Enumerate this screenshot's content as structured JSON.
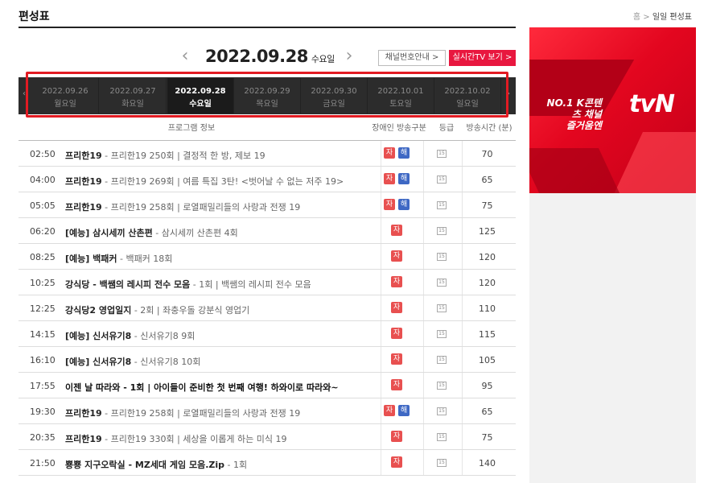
{
  "header": {
    "title": "편성표",
    "breadcrumb_home": "홈",
    "breadcrumb_sep": ">",
    "breadcrumb_current": "일일 편성표"
  },
  "datebar": {
    "prev_symbol": "‹",
    "next_symbol": "›",
    "current_date": "2022.09.28",
    "current_dow": "수요일",
    "guide_label": "채널번호안내 >",
    "live_label": "실시간TV 보기 >"
  },
  "days": [
    {
      "date": "2022.09.26",
      "dow": "월요일",
      "active": false
    },
    {
      "date": "2022.09.27",
      "dow": "화요일",
      "active": false
    },
    {
      "date": "2022.09.28",
      "dow": "수요일",
      "active": true
    },
    {
      "date": "2022.09.29",
      "dow": "목요일",
      "active": false
    },
    {
      "date": "2022.09.30",
      "dow": "금요일",
      "active": false
    },
    {
      "date": "2022.10.01",
      "dow": "토요일",
      "active": false
    },
    {
      "date": "2022.10.02",
      "dow": "일요일",
      "active": false
    }
  ],
  "table": {
    "headers": [
      "프로그램 정보",
      "장애인 방송구분",
      "등급",
      "방송시간 (분)"
    ],
    "badge_subtitle": "자",
    "badge_sign": "해",
    "grade_label": "15",
    "rows": [
      {
        "time": "02:50",
        "name": "프리한19",
        "detail": " - 프리한19 250회 | 결정적 한 방, 제보 19",
        "sign": true,
        "bold": false,
        "duration": "70"
      },
      {
        "time": "04:00",
        "name": "프리한19",
        "detail": " - 프리한19 269회 | 여름 특집 3탄! <벗어날 수 없는 저주 19>",
        "sign": true,
        "bold": false,
        "duration": "65"
      },
      {
        "time": "05:05",
        "name": "프리한19",
        "detail": " - 프리한19 258회 | 로열패밀리들의 사랑과 전쟁 19",
        "sign": true,
        "bold": false,
        "duration": "75"
      },
      {
        "time": "06:20",
        "name": "[예능] 삼시세끼 산촌편",
        "detail": " - 삼시세끼 산촌편 4회",
        "sign": false,
        "bold": false,
        "duration": "125"
      },
      {
        "time": "08:25",
        "name": "[예능] 백패커",
        "detail": " - 백패커 18회",
        "sign": false,
        "bold": false,
        "duration": "120"
      },
      {
        "time": "10:25",
        "name": "강식당 - 백쌤의 레시피 전수 모음",
        "detail": " - 1회 | 백쌤의 레시피 전수 모음",
        "sign": false,
        "bold": false,
        "duration": "120"
      },
      {
        "time": "12:25",
        "name": "강식당2 영업일지",
        "detail": " - 2회 | 좌충우돌 강분식 영업기",
        "sign": false,
        "bold": false,
        "duration": "110"
      },
      {
        "time": "14:15",
        "name": "[예능] 신서유기8",
        "detail": " - 신서유기8 9회",
        "sign": false,
        "bold": false,
        "duration": "115"
      },
      {
        "time": "16:10",
        "name": "[예능] 신서유기8",
        "detail": " - 신서유기8 10회",
        "sign": false,
        "bold": false,
        "duration": "105"
      },
      {
        "time": "17:55",
        "name": "이젠 날 따라와",
        "detail": " - 1회 | 아이들이 준비한 첫 번째 여행! 하와이로 따라와~",
        "sign": false,
        "bold": true,
        "duration": "95"
      },
      {
        "time": "19:30",
        "name": "프리한19",
        "detail": " - 프리한19 258회 | 로열패밀리들의 사랑과 전쟁 19",
        "sign": true,
        "bold": false,
        "duration": "65"
      },
      {
        "time": "20:35",
        "name": "프리한19",
        "detail": " - 프리한19 330회  | 세상을 이롭게 하는 미식 19",
        "sign": false,
        "bold": false,
        "duration": "75"
      },
      {
        "time": "21:50",
        "name": "뿅뿅 지구오락실 - MZ세대 게임 모음.Zip",
        "detail": " - 1회",
        "sign": false,
        "bold": false,
        "duration": "140"
      }
    ]
  },
  "ad": {
    "copy_line1": "NO.1 K콘텐츠 채널",
    "copy_line2": "즐거움엔",
    "logo": "tvN",
    "brand_color": "#e3061f"
  }
}
